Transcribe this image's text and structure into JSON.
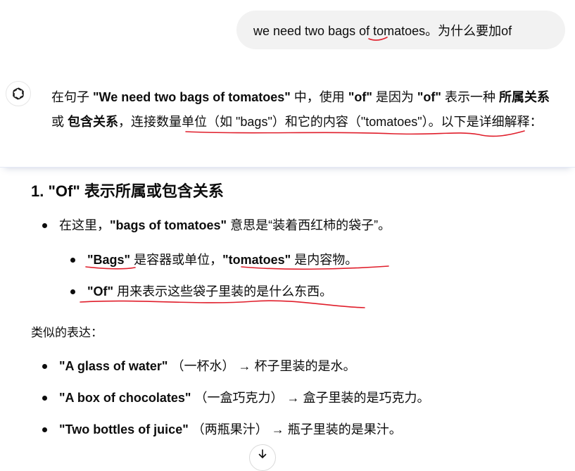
{
  "user_message": "we need two bags of tomatoes。为什么要加of",
  "assistant": {
    "intro": {
      "t1": "在句子 ",
      "b1": "\"We need two bags of tomatoes\"",
      "t2": " 中，使用 ",
      "b2": "\"of\"",
      "t3": " 是因为 ",
      "b3": "\"of\"",
      "t4": " 表示一种 ",
      "b4": "所属关系",
      "t5": " 或 ",
      "b5": "包含关系",
      "t6": "，连接数量单位（如 \"bags\"）和它的内容（\"tomatoes\"）。以下是详细解释："
    },
    "section_title": "1. \"Of\" 表示所属或包含关系",
    "bullet1": {
      "t1": "在这里，",
      "b1": "\"bags of tomatoes\"",
      "t2": " 意思是“装着西红柿的袋子”。"
    },
    "sub1": {
      "b1": "\"Bags\"",
      "t1": " 是容器或单位，",
      "b2": "\"tomatoes\"",
      "t2": " 是内容物。"
    },
    "sub2": {
      "b1": "\"Of\"",
      "t1": " 用来表示这些袋子里装的是什么东西。"
    },
    "similar_label": "类似的表达：",
    "examples": [
      {
        "phrase": "\"A glass of water\"",
        "gloss": "（一杯水）",
        "arrow": "→",
        "meaning": "杯子里装的是水。"
      },
      {
        "phrase": "\"A box of chocolates\"",
        "gloss": "（一盒巧克力）",
        "arrow": "→",
        "meaning": "盒子里装的是巧克力。"
      },
      {
        "phrase": "\"Two bottles of juice\"",
        "gloss": "（两瓶果汁）",
        "arrow": "→",
        "meaning": "瓶子里装的是果汁。"
      }
    ]
  },
  "icons": {
    "avatar": "chatgpt-logo-icon",
    "scroll": "arrow-down-icon"
  },
  "colors": {
    "annotation": "#e01e2b",
    "bubble": "#f2f2f2"
  }
}
